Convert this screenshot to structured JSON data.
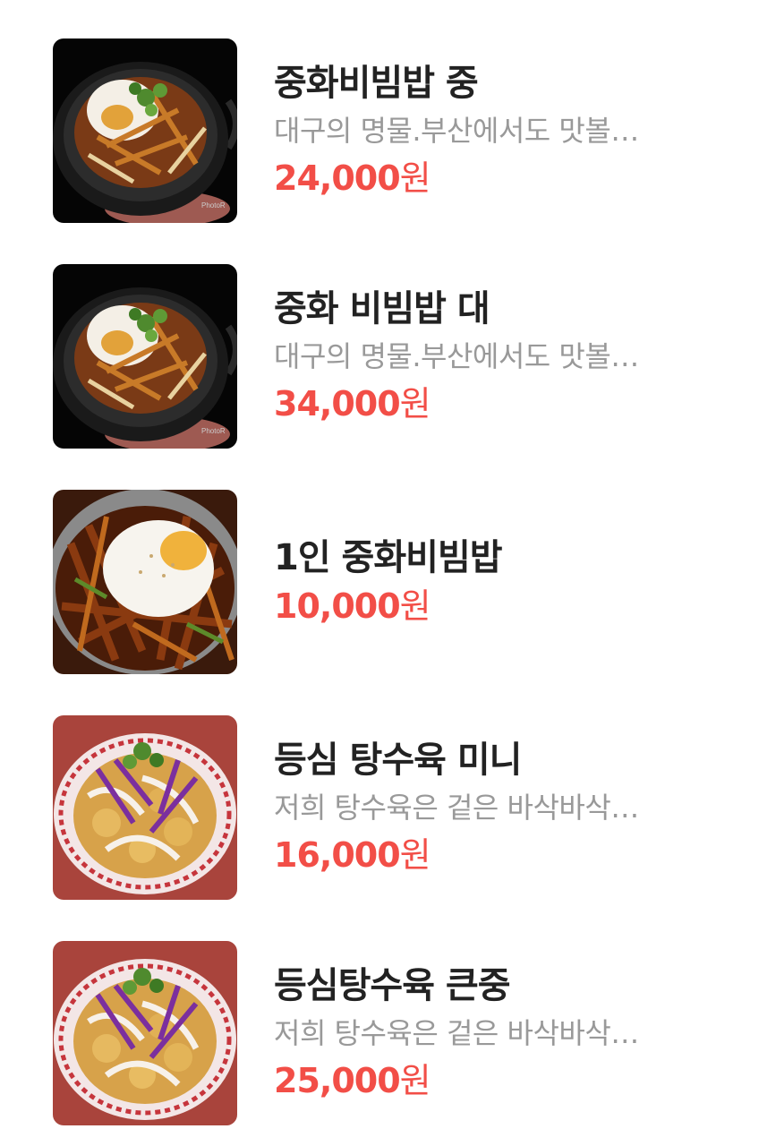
{
  "menu_items": [
    {
      "name": "중화비빔밥 중",
      "description": "대구의 명물.부산에서도 맛볼…",
      "price": "24,000",
      "currency": "원",
      "image": "bibimbap-hotplate-photo",
      "watermark": "PhotoR"
    },
    {
      "name": "중화 비빔밥 대",
      "description": "대구의 명물.부산에서도 맛볼…",
      "price": "34,000",
      "currency": "원",
      "image": "bibimbap-hotplate-photo",
      "watermark": "PhotoR"
    },
    {
      "name": "1인 중화비빔밥",
      "description": "",
      "price": "10,000",
      "currency": "원",
      "image": "bibimbap-pan-photo"
    },
    {
      "name": "등심 탕수육 미니",
      "description": "저희 탕수육은 겉은 바삭바삭…",
      "price": "16,000",
      "currency": "원",
      "image": "tangsuyuk-plate-photo"
    },
    {
      "name": "등심탕수육 큰중",
      "description": "저희 탕수육은 겉은 바삭바삭…",
      "price": "25,000",
      "currency": "원",
      "image": "tangsuyuk-plate-photo"
    }
  ],
  "colors": {
    "price": "#f24e47",
    "name": "#222222",
    "description": "#999999"
  }
}
